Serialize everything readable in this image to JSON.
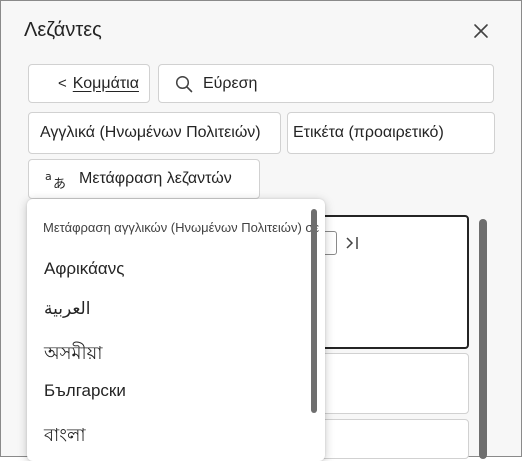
{
  "pane": {
    "title": "Λεζάντες",
    "close_icon": "close-icon"
  },
  "toolbar": {
    "back_chevron": "<",
    "back_label": "Κομμάτια",
    "search_icon": "search-icon",
    "search_label": "Εύρεση",
    "language": "Αγγλικά (Ηνωμένων Πολιτειών)",
    "tag": "Ετικέτα (προαιρετικό)",
    "translate_icon": "translate-icon",
    "translate_label": "Μετάφραση λεζαντών"
  },
  "editor": {
    "jump_icon": "jump-to-end-icon"
  },
  "menu": {
    "header": "Μετάφραση αγγλικών (Ηνωμένων Πολιτειών) σε",
    "items": [
      "Αφρικάανς",
      "العربية",
      "অসমীয়া",
      "Български",
      "বাংলা"
    ]
  },
  "colors": {
    "pane_background": "#f7f7f7",
    "control_border": "#d1d1d1",
    "text": "#242424",
    "scrollbar": "#6e6e6e"
  }
}
